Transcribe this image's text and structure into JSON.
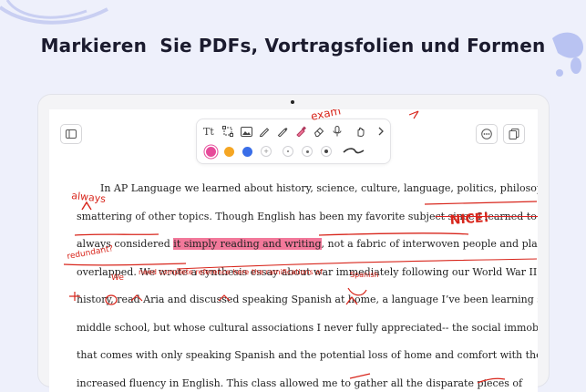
{
  "headline": "Markieren  Sie PDFs, Vortragsfolien und Formen",
  "toolbar": {
    "tools": [
      "text-tool-icon",
      "shape-select-icon",
      "image-icon",
      "pen-icon",
      "pencil-icon",
      "highlighter-icon",
      "eraser-icon",
      "microphone-icon",
      "lasso-hand-icon"
    ],
    "colors": [
      "#e64a9a",
      "#f5a623",
      "#3a6ee8"
    ],
    "stroke_sizes": [
      "+",
      "•",
      "•",
      "•"
    ]
  },
  "document": {
    "lines": [
      {
        "parts": [
          {
            "t": "In AP Language we learned about history, science, culture, language, politics, philosophy, and a"
          }
        ]
      },
      {
        "parts": [
          {
            "t": "smattering of other topics. Though English has been my favorite subje"
          },
          {
            "t": "ct since I learned to read, I",
            "style": "strike"
          }
        ]
      },
      {
        "parts": [
          {
            "t": "always considered "
          },
          {
            "t": "it simply reading and writing",
            "style": "hl"
          },
          {
            "t": ", not a fabric of interwoven people and places that"
          }
        ]
      },
      {
        "parts": [
          {
            "t": "overlapped. We wrote a synthesis essay about war immediately following our World War II unit in"
          }
        ]
      },
      {
        "parts": [
          {
            "t": "history, read Aria and discussed speaking Spanish at home, a language I’ve been learning since"
          }
        ]
      },
      {
        "parts": [
          {
            "t": "middle school, but whose cultural associations I never fully appreciated-- the social immobility"
          }
        ]
      },
      {
        "parts": [
          {
            "t": "that comes with only speaking Spanish and the potential loss of home and comfort with the"
          }
        ]
      },
      {
        "parts": [
          {
            "t": "increased fluency in English. This class allowed me to gather all the disparate pieces of"
          }
        ]
      }
    ]
  },
  "annotations": {
    "always": "always",
    "nice": "NICE!",
    "redundant": "redundant?",
    "we": "We",
    "need_ref": "need complete reference here",
    "ramifications": "the ramifications of",
    "spanish": "Spanish",
    "example": "exam"
  }
}
